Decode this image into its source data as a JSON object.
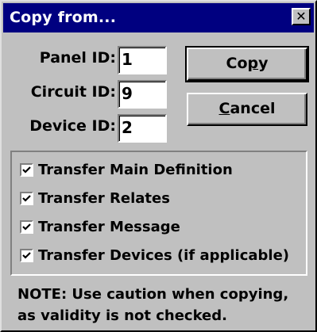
{
  "window": {
    "title": "Copy from...",
    "close_glyph": "✕"
  },
  "fields": [
    {
      "label": "Panel ID:",
      "value": "1"
    },
    {
      "label": "Circuit ID:",
      "value": "9"
    },
    {
      "label": "Device ID:",
      "value": "2"
    }
  ],
  "buttons": {
    "copy": {
      "pre": "Co",
      "accel": "p",
      "post": "y"
    },
    "cancel": {
      "pre": "",
      "accel": "C",
      "post": "ancel"
    }
  },
  "options": [
    {
      "label": "Transfer Main Definition",
      "checked": true
    },
    {
      "label": "Transfer Relates",
      "checked": true
    },
    {
      "label": "Transfer Message",
      "checked": true
    },
    {
      "label": "Transfer Devices (if applicable)",
      "checked": true
    }
  ],
  "note": {
    "line1": "NOTE: Use caution when copying,",
    "line2": "as validity is not checked."
  }
}
